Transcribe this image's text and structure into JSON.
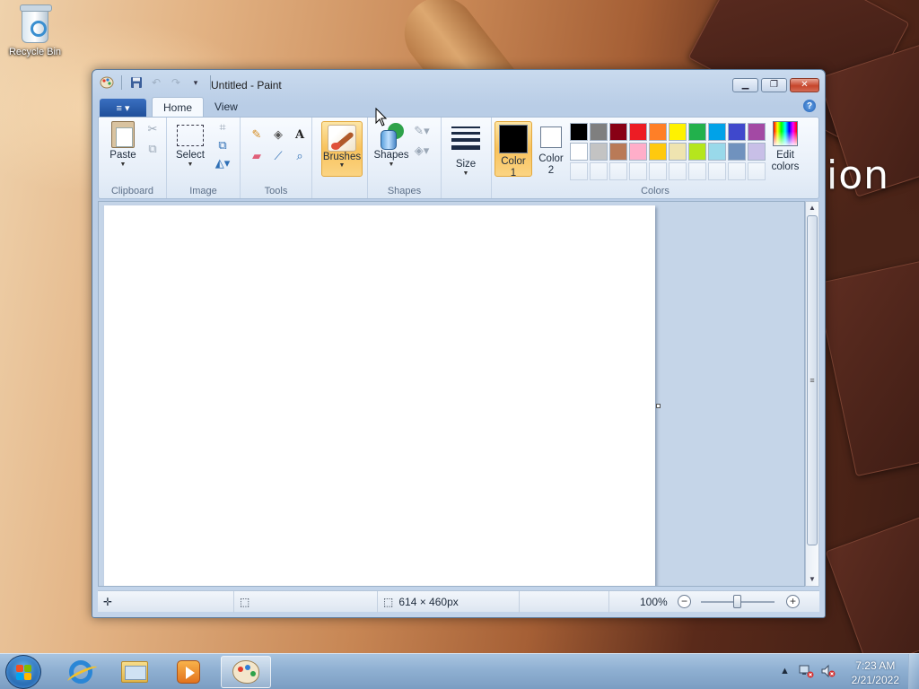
{
  "desktop": {
    "recycle_bin_label": "Recycle Bin",
    "watermark_text": "ion"
  },
  "window": {
    "title": "Untitled - Paint",
    "buttons": {
      "minimize": "▁",
      "restore": "❐",
      "close": "✕"
    }
  },
  "qat": {
    "app_menu_icon": "paint-app-icon",
    "save_icon": "save-icon",
    "undo_icon": "undo-icon",
    "redo_icon": "redo-icon",
    "customize_icon": "dropdown-icon"
  },
  "ribbon": {
    "file_tab": "≡ ▾",
    "tabs": [
      {
        "label": "Home",
        "active": true
      },
      {
        "label": "View",
        "active": false
      }
    ],
    "groups": {
      "clipboard": {
        "label": "Clipboard",
        "paste": "Paste"
      },
      "image": {
        "label": "Image",
        "select": "Select"
      },
      "tools": {
        "label": "Tools"
      },
      "brushes": {
        "label": "Brushes"
      },
      "shapes": {
        "label": "Shapes",
        "shapes_btn": "Shapes"
      },
      "size": {
        "label": "Size"
      },
      "colors": {
        "label": "Colors",
        "color1": {
          "label_line1": "Color",
          "label_line2": "1",
          "value": "#000000"
        },
        "color2": {
          "label_line1": "Color",
          "label_line2": "2",
          "value": "#ffffff"
        },
        "edit_colors_line1": "Edit",
        "edit_colors_line2": "colors",
        "palette_row1": [
          "#000000",
          "#7f7f7f",
          "#880015",
          "#ed1c24",
          "#ff7f27",
          "#fff200",
          "#22b14c",
          "#00a2e8",
          "#3f48cc",
          "#a349a4"
        ],
        "palette_row2": [
          "#ffffff",
          "#c3c3c3",
          "#b97a57",
          "#ffaec9",
          "#ffc90e",
          "#efe4b0",
          "#b5e61d",
          "#99d9ea",
          "#7092be",
          "#c8bfe7"
        ]
      }
    }
  },
  "statusbar": {
    "image_size": "614 × 460px",
    "zoom": "100%"
  },
  "taskbar": {
    "apps": [
      "internet-explorer",
      "windows-explorer",
      "windows-media-player",
      "paint"
    ],
    "time": "7:23 AM",
    "date": "2/21/2022"
  }
}
